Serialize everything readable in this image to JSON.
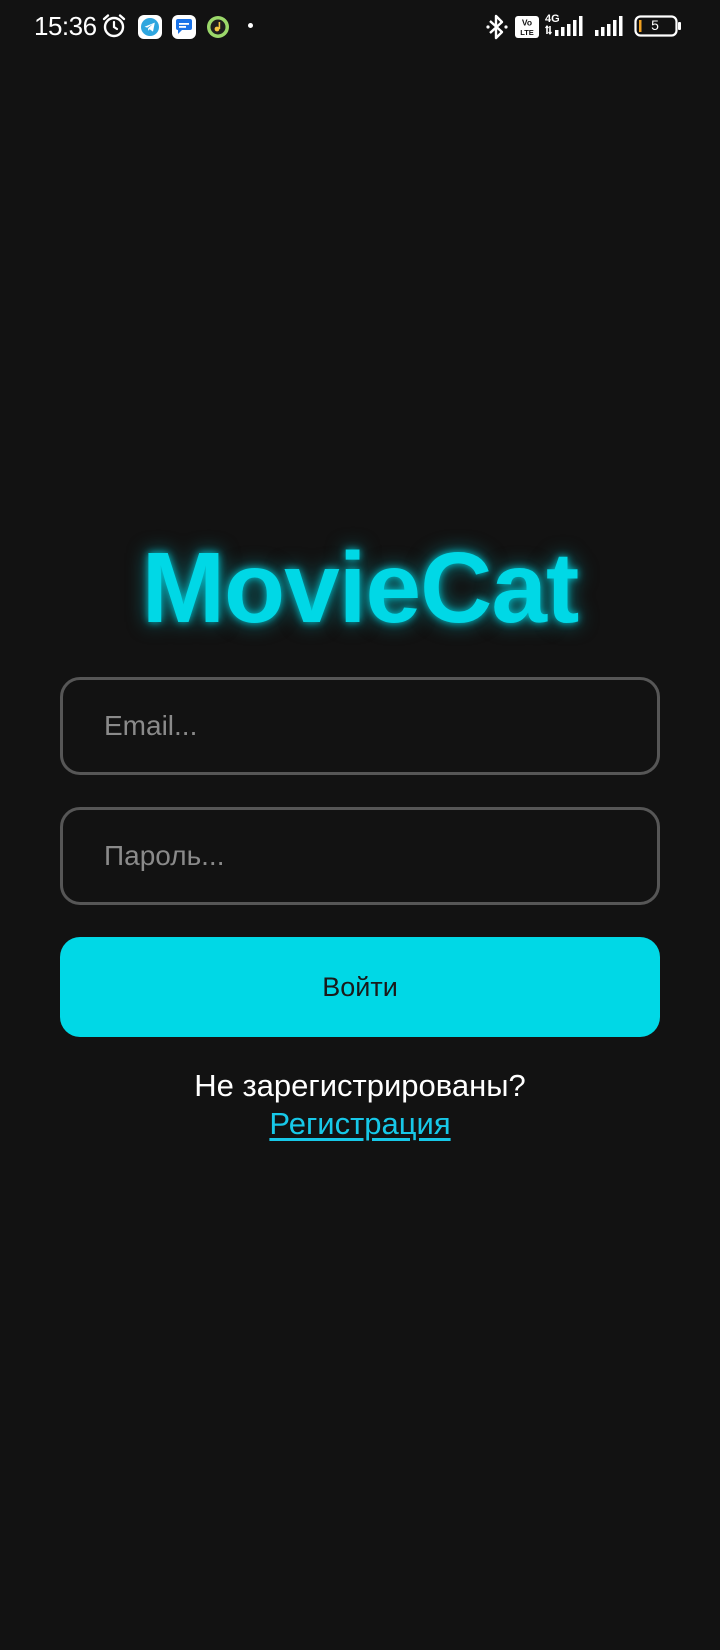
{
  "status_bar": {
    "time": "15:36",
    "battery_level": "5",
    "network": "4G",
    "left_icons": [
      "alarm-icon",
      "telegram-icon",
      "messages-icon",
      "music-icon",
      "notification-dot-icon"
    ],
    "right_icons": [
      "bluetooth-icon",
      "volte-icon",
      "signal-icon",
      "signal-icon",
      "battery-icon"
    ]
  },
  "app": {
    "title": "MovieCat",
    "accent_color": "#00d8e6",
    "background_color": "#121212"
  },
  "login_form": {
    "email_placeholder": "Email...",
    "email_value": "",
    "password_placeholder": "Пароль...",
    "password_value": "",
    "submit_label": "Войти"
  },
  "register": {
    "question": "Не зарегистрированы?",
    "link_label": "Регистрация"
  }
}
